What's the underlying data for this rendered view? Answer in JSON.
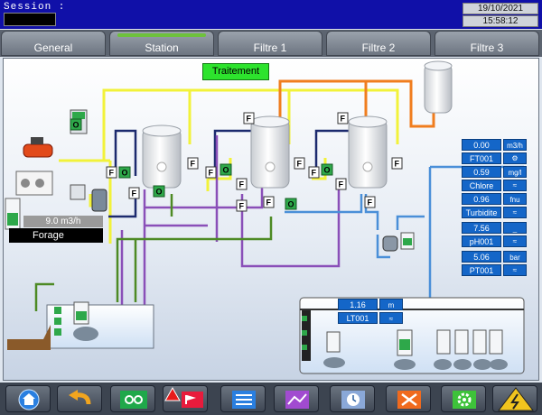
{
  "header": {
    "session_label": "Session :",
    "date": "19/10/2021",
    "time": "15:58:12"
  },
  "tabs": [
    {
      "label": "General",
      "active": false
    },
    {
      "label": "Station",
      "active": true
    },
    {
      "label": "Filtre 1",
      "active": false
    },
    {
      "label": "Filtre 2",
      "active": false
    },
    {
      "label": "Filtre 3",
      "active": false
    }
  ],
  "process": {
    "treatment_button": "Traitement",
    "well_flow": "9.0 m3/h",
    "well_label": "Forage",
    "valve_flag": "F",
    "open_flag": "O"
  },
  "measurements": [
    {
      "value": "0.00",
      "unit": "m3/h"
    },
    {
      "value": "FT001",
      "icon": "flow-meter-icon"
    },
    {
      "value": "0.59",
      "unit": "mg/l"
    },
    {
      "value": "Chlore",
      "icon": "trend-icon"
    },
    {
      "value": "0.96",
      "unit": "fnu"
    },
    {
      "value": "Turbidite",
      "icon": "trend-icon"
    },
    {
      "value": "7.56",
      "unit": "_"
    },
    {
      "value": "pH001",
      "icon": "trend-icon"
    },
    {
      "value": "5.06",
      "unit": "bar"
    },
    {
      "value": "PT001",
      "icon": "trend-icon"
    }
  ],
  "tank_level": {
    "value": "1.16",
    "unit": "m",
    "tag": "LT001"
  },
  "colors": {
    "header_bg": "#1010a8",
    "pipe_yellow": "#f2f23a",
    "pipe_orange": "#f07d1e",
    "pipe_blue": "#4a8fd8",
    "pipe_purple": "#8a4fb8",
    "pipe_green": "#4d8a24",
    "pipe_navy": "#1c2a6e",
    "display_blue": "#1466c8",
    "active_green": "#2de32d"
  },
  "nav_buttons": [
    {
      "name": "home-button",
      "icon": "home-icon"
    },
    {
      "name": "back-button",
      "icon": "back-arrow-icon"
    },
    {
      "name": "glasses-button",
      "icon": "glasses-icon"
    },
    {
      "name": "alarm-button",
      "icon": "alarm-flag-icon"
    },
    {
      "name": "list-button",
      "icon": "list-icon"
    },
    {
      "name": "trend-button",
      "icon": "chart-icon"
    },
    {
      "name": "clock-button",
      "icon": "clock-icon"
    },
    {
      "name": "tools-button",
      "icon": "tools-icon"
    },
    {
      "name": "settings-button",
      "icon": "gear-icon"
    },
    {
      "name": "electrical-button",
      "icon": "high-voltage-icon"
    }
  ]
}
